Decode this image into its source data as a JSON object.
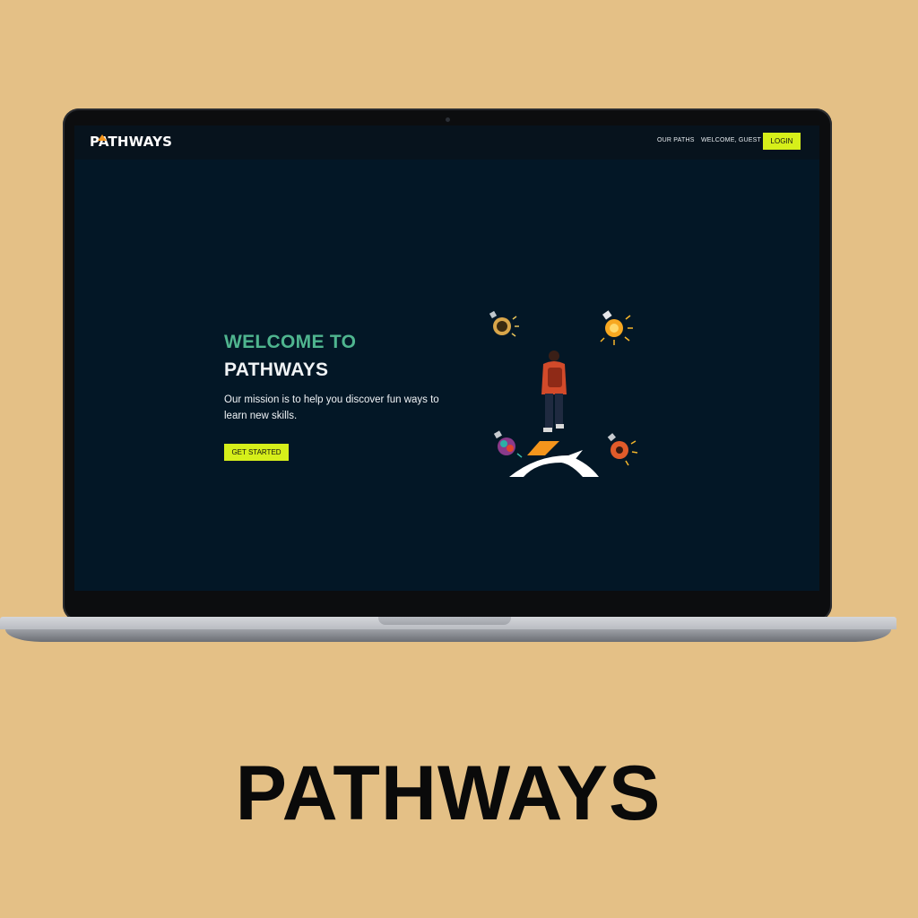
{
  "site": {
    "logo_text": "PATHWAYS",
    "accent_color": "#d6ef1a",
    "brand_green": "#4fb58f",
    "background_color": "#031726"
  },
  "nav": {
    "our_paths": "OUR PATHS",
    "welcome_guest": "WELCOME, GUEST",
    "login": "LOGIN"
  },
  "hero": {
    "title_line1": "WELCOME TO",
    "title_line2": "PATHWAYS",
    "description": "Our mission is to help you discover fun ways to learn new skills.",
    "cta_label": "GET STARTED",
    "illustration_icons": [
      "idea-bulb-icon",
      "lightbulb-icon",
      "brain-bulb-icon",
      "gear-bulb-icon",
      "walking-person-figure"
    ]
  },
  "caption": {
    "text": "PATHWAYS"
  }
}
